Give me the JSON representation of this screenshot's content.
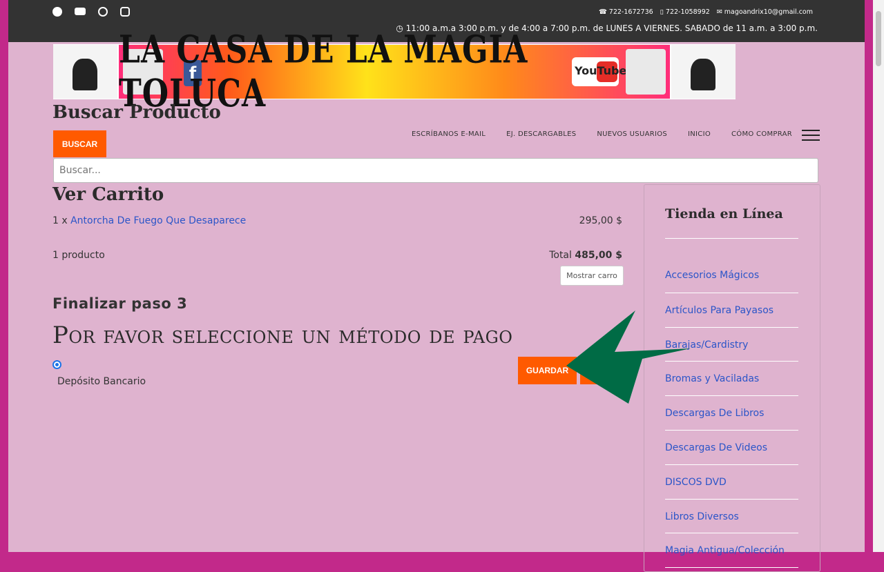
{
  "header": {
    "social_icons": [
      "facebook-icon",
      "youtube-icon",
      "whatsapp-icon",
      "instagram-icon"
    ],
    "phone1": "722-1672736",
    "phone2": "722-1058992",
    "email": "magoandrix10@gmail.com",
    "hours": "11:00 a.m.a 3:00 p.m. y de 4:00 a 7:00 p.m. de LUNES A VIERNES. SABADO de 11 a.m. a 3:00 p.m."
  },
  "banner": {
    "title": "LA CASA DE LA MAGIA TOLUCA",
    "fb_letter": "f",
    "yt_text": "YouTube"
  },
  "site": {
    "title": "Buscar Producto",
    "search_button": "BUSCAR",
    "search_placeholder": "Buscar..."
  },
  "nav": {
    "items": [
      "ESCRÍBANOS E-MAIL",
      "EJ. DESCARGABLES",
      "NUEVOS USUARIOS",
      "INICIO",
      "CÓMO COMPRAR"
    ]
  },
  "cart": {
    "title": "Ver Carrito",
    "qty": "1 x",
    "product_name": "Antorcha De Fuego Que Desaparece",
    "product_price": "295,00 $",
    "count": "1 producto",
    "total_label": "Total",
    "total_value": "485,00 $",
    "show_cart": "Mostrar carro"
  },
  "checkout": {
    "step": "Finalizar paso 3",
    "payment_title": "Por favor seleccione un método de pago",
    "method": "Depósito Bancario",
    "save_button": "GUARDAR",
    "cancel_button": ""
  },
  "sidebar": {
    "title": "Tienda en Línea",
    "items": [
      "Accesorios Mágicos",
      "Artículos Para Payasos",
      "Barajas/Cardistry",
      "Bromas y Vaciladas",
      "Descargas De Libros",
      "Descargas De Videos",
      "DISCOS DVD",
      "Libros Diversos",
      "Magia Antigua/Colección"
    ]
  },
  "colors": {
    "accent": "#ff5a00",
    "page_bg": "#dfb3cf",
    "outer_bg": "#c2298a",
    "topbar_bg": "#333333",
    "link": "#2b55c8",
    "arrow": "#006b45"
  }
}
